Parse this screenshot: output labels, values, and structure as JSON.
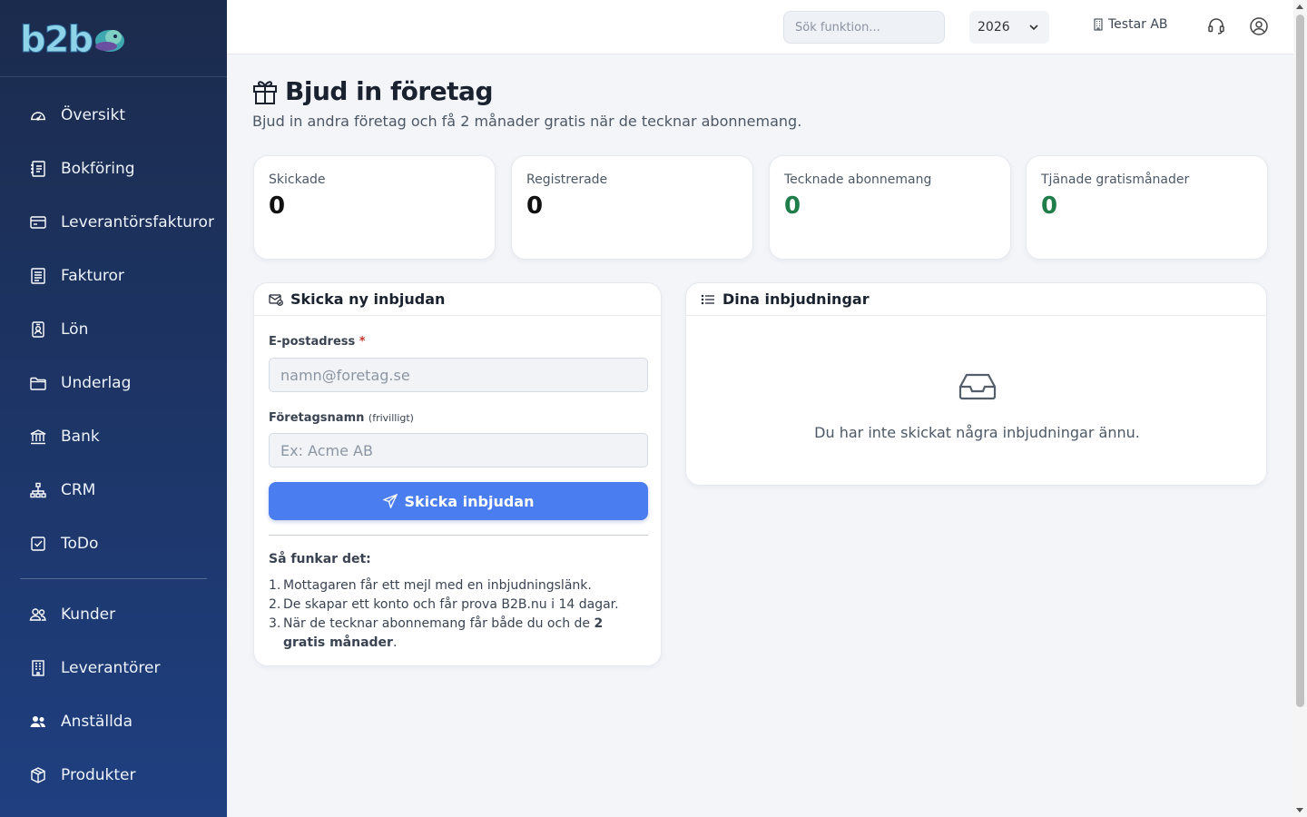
{
  "app": {
    "logo_text": "b2b"
  },
  "sidebar": {
    "items": [
      {
        "label": "Översikt",
        "icon": "speedometer-icon"
      },
      {
        "label": "Bokföring",
        "icon": "journal-icon"
      },
      {
        "label": "Leverantörsfakturor",
        "icon": "credit-card-icon"
      },
      {
        "label": "Fakturor",
        "icon": "invoice-icon"
      },
      {
        "label": "Lön",
        "icon": "person-badge-icon"
      },
      {
        "label": "Underlag",
        "icon": "folder-icon"
      },
      {
        "label": "Bank",
        "icon": "bank-icon"
      },
      {
        "label": "CRM",
        "icon": "diagram-icon"
      },
      {
        "label": "ToDo",
        "icon": "check-square-icon"
      }
    ],
    "items2": [
      {
        "label": "Kunder",
        "icon": "people-icon"
      },
      {
        "label": "Leverantörer",
        "icon": "building-icon"
      },
      {
        "label": "Anställda",
        "icon": "people-fill-icon"
      },
      {
        "label": "Produkter",
        "icon": "box-icon"
      }
    ]
  },
  "topbar": {
    "search_placeholder": "Sök funktion...",
    "year": "2026",
    "company": "Testar AB"
  },
  "page": {
    "title": "Bjud in företag",
    "subtitle": "Bjud in andra företag och få 2 månader gratis när de tecknar abonnemang."
  },
  "stats": [
    {
      "label": "Skickade",
      "value": "0"
    },
    {
      "label": "Registrerade",
      "value": "0"
    },
    {
      "label": "Tecknade abonnemang",
      "value": "0"
    },
    {
      "label": "Tjänade gratismånader",
      "value": "0"
    }
  ],
  "invite_form": {
    "title": "Skicka ny inbjudan",
    "email_label": "E-postadress",
    "email_required_mark": "*",
    "email_placeholder": "namn@foretag.se",
    "company_label": "Företagsnamn",
    "company_optional": "(frivilligt)",
    "company_placeholder": "Ex: Acme AB",
    "submit_label": "Skicka inbjudan",
    "how_title": "Så funkar det:",
    "steps": [
      {
        "num": "1.",
        "text": "Mottagaren får ett mejl med en inbjudningslänk."
      },
      {
        "num": "2.",
        "text": "De skapar ett konto och får prova B2B.nu i 14 dagar."
      },
      {
        "num": "3.",
        "text_before": "När de tecknar abonnemang får både du och de ",
        "bold": "2 gratis månader",
        "text_after": "."
      }
    ]
  },
  "invitations": {
    "title": "Dina inbjudningar",
    "empty_text": "Du har inte skickat några inbjudningar ännu."
  },
  "colors": {
    "sidebar_top": "#1b2b4d",
    "sidebar_bottom": "#1f3f80",
    "accent": "#4a7df0",
    "green": "#1f7d4a"
  }
}
